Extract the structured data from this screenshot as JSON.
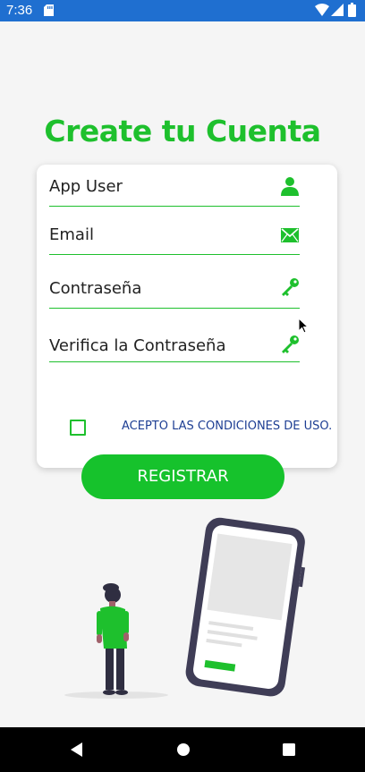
{
  "status_bar": {
    "time": "7:36",
    "icons": [
      "sd-card-icon",
      "wifi-icon",
      "signal-icon",
      "battery-icon"
    ]
  },
  "title": "Create tu Cuenta",
  "form": {
    "fields": [
      {
        "value": "App User",
        "icon": "person-icon"
      },
      {
        "value": "Email",
        "icon": "envelope-icon"
      },
      {
        "value": "Contraseña",
        "icon": "key-icon"
      },
      {
        "value": "Verifica la Contraseña",
        "icon": "key-icon"
      }
    ],
    "terms_checkbox_checked": false,
    "terms_label": "ACEPTO LAS CONDICIONES DE USO."
  },
  "register_label": "REGISTRAR",
  "colors": {
    "accent": "#1ec02d",
    "status_bar": "#1f6fd0",
    "terms_text": "#1d3e93"
  },
  "nav_bar": {
    "icons": [
      "back-icon",
      "home-icon",
      "recents-icon"
    ]
  }
}
